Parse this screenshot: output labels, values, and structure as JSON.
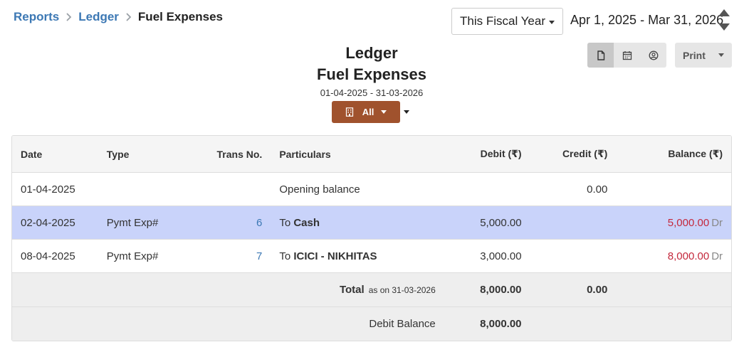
{
  "breadcrumb": {
    "items": [
      "Reports",
      "Ledger"
    ],
    "current": "Fuel Expenses"
  },
  "period": {
    "selected": "This Fiscal Year",
    "range_text": "Apr 1, 2025 - Mar 31, 2026"
  },
  "toolbar": {
    "print_label": "Print",
    "icons": [
      "document-icon",
      "calendar-icon",
      "user-circle-icon"
    ]
  },
  "report": {
    "title": "Ledger",
    "subtitle": "Fuel Expenses",
    "date_range": "01-04-2025 - 31-03-2026",
    "branch_label": "All"
  },
  "table": {
    "headers": {
      "date": "Date",
      "type": "Type",
      "trans": "Trans No.",
      "particulars": "Particulars",
      "debit": "Debit (₹)",
      "credit": "Credit (₹)",
      "balance": "Balance (₹)"
    },
    "opening": {
      "date": "01-04-2025",
      "particulars": "Opening balance",
      "credit": "0.00"
    },
    "rows": [
      {
        "date": "02-04-2025",
        "type": "Pymt Exp#",
        "trans": "6",
        "prefix": "To",
        "account": "Cash",
        "debit": "5,000.00",
        "credit": "",
        "balance": "5,000.00",
        "drcr": "Dr"
      },
      {
        "date": "08-04-2025",
        "type": "Pymt Exp#",
        "trans": "7",
        "prefix": "To",
        "account": "ICICI - NIKHITAS",
        "debit": "3,000.00",
        "credit": "",
        "balance": "8,000.00",
        "drcr": "Dr"
      }
    ],
    "total": {
      "label": "Total",
      "as_on": "as on 31-03-2026",
      "debit": "8,000.00",
      "credit": "0.00"
    },
    "balance_row": {
      "label": "Debit Balance",
      "value": "8,000.00"
    }
  },
  "colors": {
    "link": "#3c78b4",
    "branch_button": "#a0522d",
    "selected_row": "#c9d3fa",
    "debit_balance": "#c4283c"
  }
}
